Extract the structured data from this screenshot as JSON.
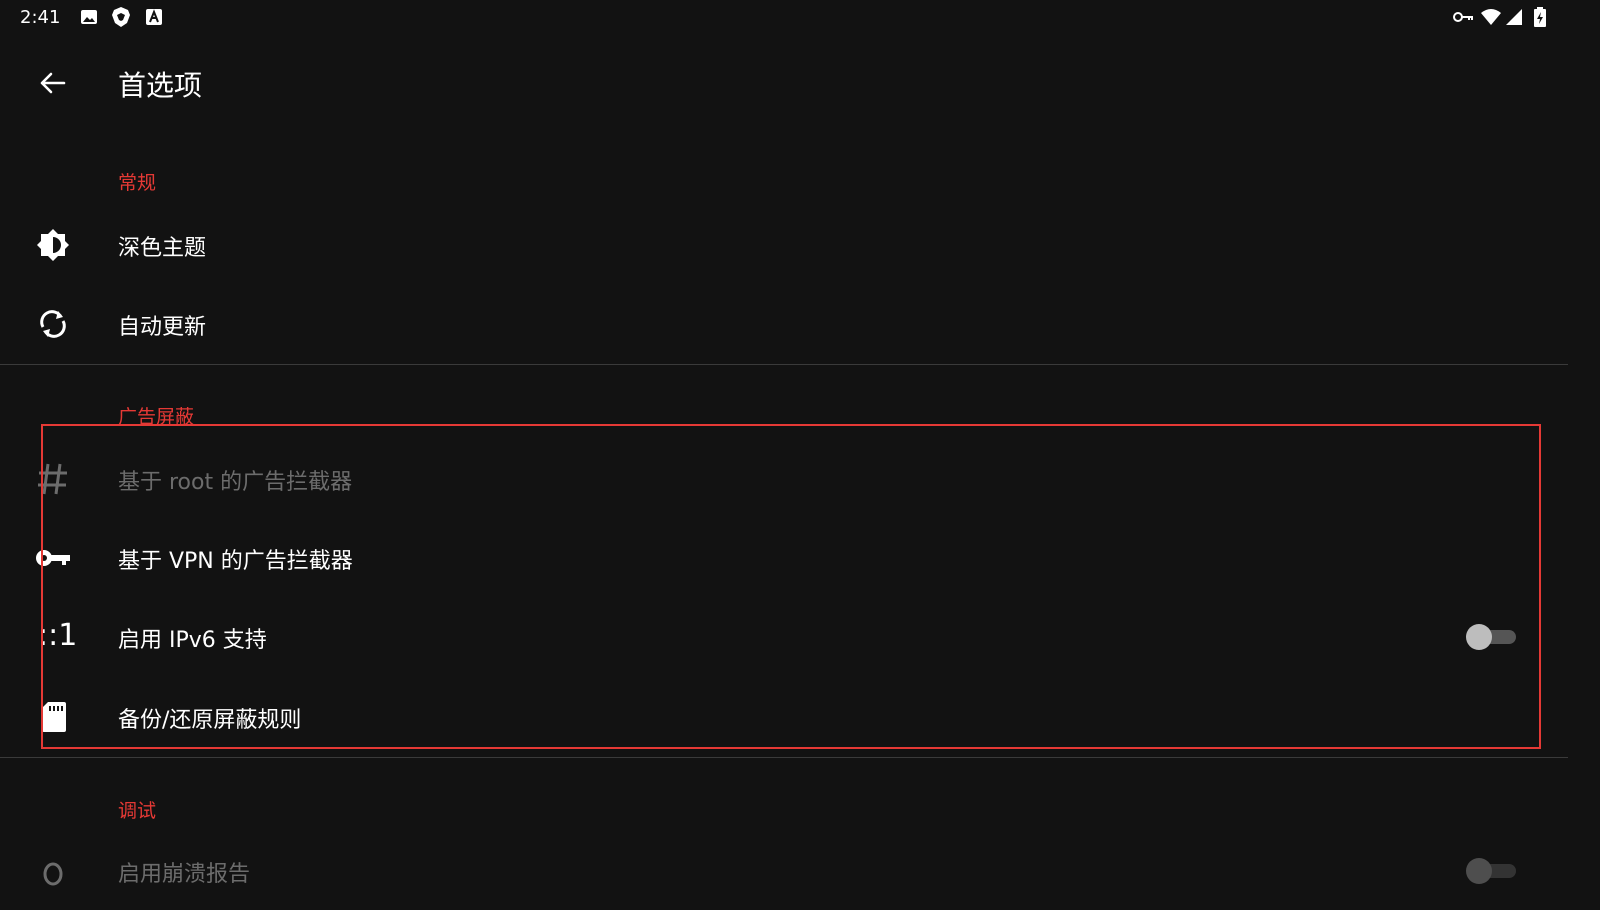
{
  "status_bar": {
    "time": "2:41",
    "left_icons": [
      "image-icon",
      "brave-lion-icon",
      "a-text-icon"
    ],
    "right_icons": [
      "vpn-key-icon",
      "wifi-icon",
      "signal-icon",
      "battery-charging-icon"
    ]
  },
  "toolbar": {
    "title": "首选项",
    "back_icon": "arrow-left-icon"
  },
  "sections": {
    "general": {
      "header": "常规",
      "items": [
        {
          "label": "深色主题",
          "icon": "brightness-icon"
        },
        {
          "label": "自动更新",
          "icon": "sync-icon"
        }
      ]
    },
    "ad_blocking": {
      "header": "广告屏蔽",
      "items": [
        {
          "label": "基于 root 的广告拦截器",
          "icon": "hash-icon",
          "enabled": false
        },
        {
          "label": "基于 VPN 的广告拦截器",
          "icon": "key-icon",
          "enabled": true
        },
        {
          "label": "启用 IPv6 支持",
          "icon_text": "::1",
          "switch_on": false
        },
        {
          "label": "备份/还原屏蔽规则",
          "icon": "sd-card-icon"
        }
      ]
    },
    "debug": {
      "header": "调试",
      "items": [
        {
          "label": "启用崩溃报告",
          "icon": "bug-icon",
          "enabled": false,
          "switch_on": false
        }
      ]
    }
  },
  "colors": {
    "background": "#121212",
    "accent": "#e53935",
    "text": "#ffffff",
    "disabled_text": "#6c6c6c",
    "highlight_border": "#e53935"
  }
}
